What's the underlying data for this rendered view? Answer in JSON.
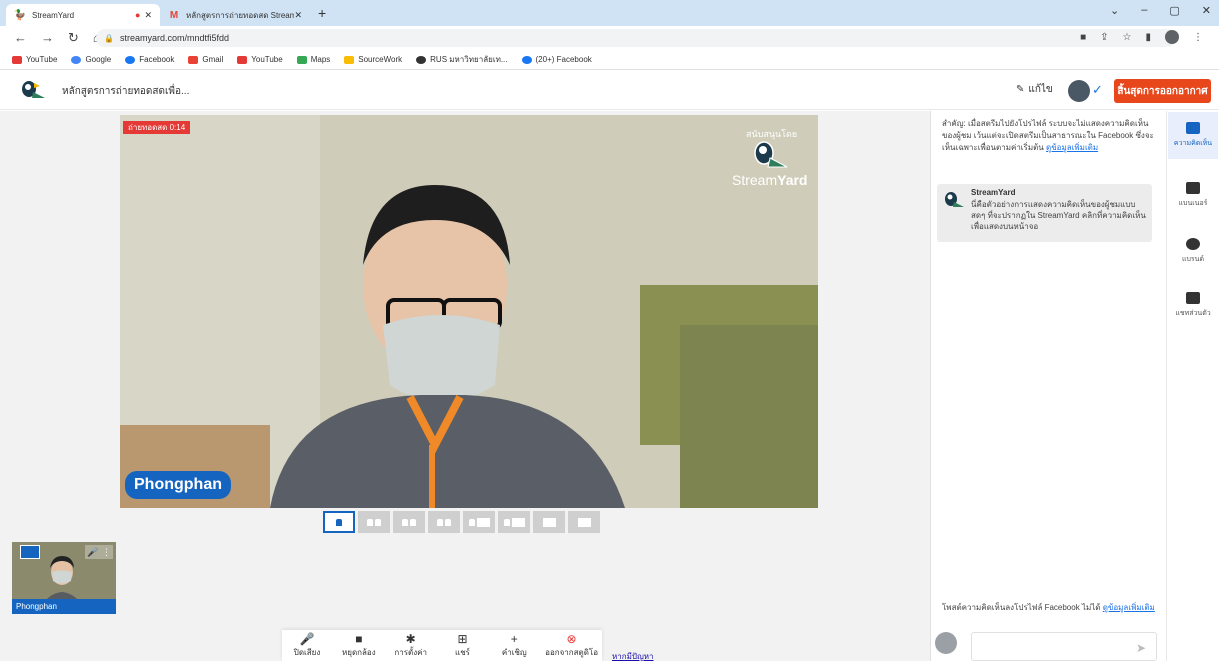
{
  "browser": {
    "tabs": [
      {
        "title": "StreamYard",
        "active": true
      },
      {
        "title": "หลักสูตรการถ่ายทอดสด StreamYard - produ",
        "active": false
      }
    ],
    "url": "streamyard.com/mndtfi5fdd",
    "bookmarks": [
      "YouTube",
      "Google",
      "Facebook",
      "Gmail",
      "YouTube",
      "Maps",
      "SourceWork",
      "RUS มหาวิทยาลัยเท...",
      "(20+) Facebook"
    ]
  },
  "header": {
    "broadcast_title": "หลักสูตรการถ่ายทอดสดเพื่อ...",
    "edit_label": "แก้ไข",
    "end_button": "สิ้นสุดการออกอากาศ"
  },
  "stage": {
    "live_badge": "ถ่ายทอดสด 0:14",
    "sponsor_label": "สนับสนุนโดย",
    "logo_text_a": "Stream",
    "logo_text_b": "Yard",
    "participant_name": "Phongphan"
  },
  "thumbnail": {
    "name": "Phongphan"
  },
  "toolbar": [
    {
      "icon": "mic-icon",
      "glyph": "🎤",
      "label": "ปิดเสียง"
    },
    {
      "icon": "camera-icon",
      "glyph": "■",
      "label": "หยุดกล้อง"
    },
    {
      "icon": "gear-icon",
      "glyph": "✱",
      "label": "การตั้งค่า"
    },
    {
      "icon": "share-icon",
      "glyph": "⊞",
      "label": "แชร์"
    },
    {
      "icon": "invite-icon",
      "glyph": "+",
      "label": "คำเชิญ"
    },
    {
      "icon": "leave-icon",
      "glyph": "⊗",
      "label": "ออกจากสตูดิโอ"
    }
  ],
  "help_link": "หากมีปัญหา",
  "comments": {
    "notice": "สำคัญ: เมื่อสตรีมไปยังโปรไฟล์ ระบบจะไม่แสดงความคิดเห็นของผู้ชม เว้นแต่จะเปิดสตรีมเป็นสาธารณะใน Facebook ซึ่งจะเห็นเฉพาะเพื่อนตามค่าเริ่มต้น",
    "notice_link": "ดูข้อมูลเพิ่มเติม",
    "author": "StreamYard",
    "text": "นี่คือตัวอย่างการแสดงความคิดเห็นของผู้ชมแบบสดๆ ที่จะปรากฏใน StreamYard คลิกที่ความคิดเห็นเพื่อแสดงบนหน้าจอ",
    "footer": "โพสต์ความคิดเห็นลงโปรไฟล์ Facebook ไม่ได้",
    "footer_link": "ดูข้อมูลเพิ่มเติม"
  },
  "rail": [
    {
      "label": "ความคิดเห็น",
      "active": true
    },
    {
      "label": "แบนเนอร์",
      "active": false
    },
    {
      "label": "แบรนด์",
      "active": false
    },
    {
      "label": "แชทส่วนตัว",
      "active": false
    }
  ],
  "colors": {
    "accent": "#1565c0",
    "live": "#e53935",
    "end_button": "#e8471c"
  }
}
